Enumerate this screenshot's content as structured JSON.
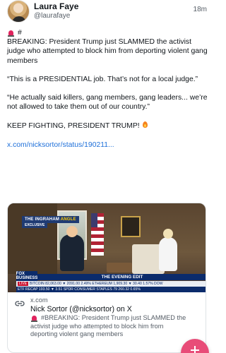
{
  "author": {
    "name": "Laura Faye",
    "handle": "@laurafaye",
    "time": "18m"
  },
  "post": {
    "tag": "#",
    "lines": [
      "BREAKING: President Trump just SLAMMED the activist judge who attempted to block him from deporting violent gang members",
      "“This is a PRESIDENTIAL job. That’s not for a local judge.”",
      "“He actually said killers, gang members, gang leaders... we’re not allowed to take them out of our country.”"
    ],
    "closing": "KEEP FIGHTING, PRESIDENT TRUMP!",
    "link": "x.com/nicksortor/status/190211..."
  },
  "card": {
    "media": {
      "show_tag_main": "THE INGRAHAM",
      "show_tag_accent": "ANGLE",
      "exclusive": "EXCLUSIVE",
      "channel": "FOX BUSINESS",
      "edit_bar": "THE EVENING EDIT",
      "ticker_row1": "BITCOIN 82,063.00 ▼ 2091.00 2.49% ETHEREUM 1,909.30 ▼ 30.40 1.57% DOW",
      "live_label": "LIVE",
      "ticker_row2": "ETF RECAP 193.50 ▼ 3.51 SPDR CONSUMER STAPLES 79 260.32 0.65%"
    },
    "domain": "x.com",
    "title": "Nick Sortor (@nicksortor) on X",
    "desc_line1": "#BREAKING: President Trump just SLAMMED the",
    "desc_line2": "activist judge who attempted to block him from",
    "desc_line3": "deporting violent gang members"
  },
  "icons": {
    "alert": "siren-icon",
    "fire": "fire-icon",
    "link": "link-icon",
    "compose": "plus-icon"
  },
  "colors": {
    "accent": "#e84c78",
    "link": "#1d6fd9"
  }
}
